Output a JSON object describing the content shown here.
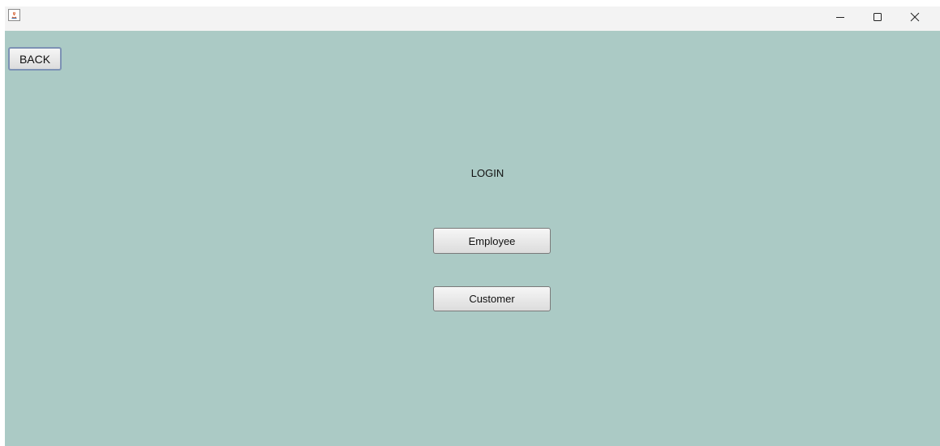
{
  "titlebar": {
    "app_icon": "java-app-icon",
    "controls": {
      "minimize_icon": "minimize-icon",
      "maximize_icon": "maximize-icon",
      "close_icon": "close-icon"
    }
  },
  "content": {
    "background_color": "#abcac5",
    "back_button": "BACK",
    "title": "LOGIN",
    "employee_button": "Employee",
    "customer_button": "Customer"
  }
}
